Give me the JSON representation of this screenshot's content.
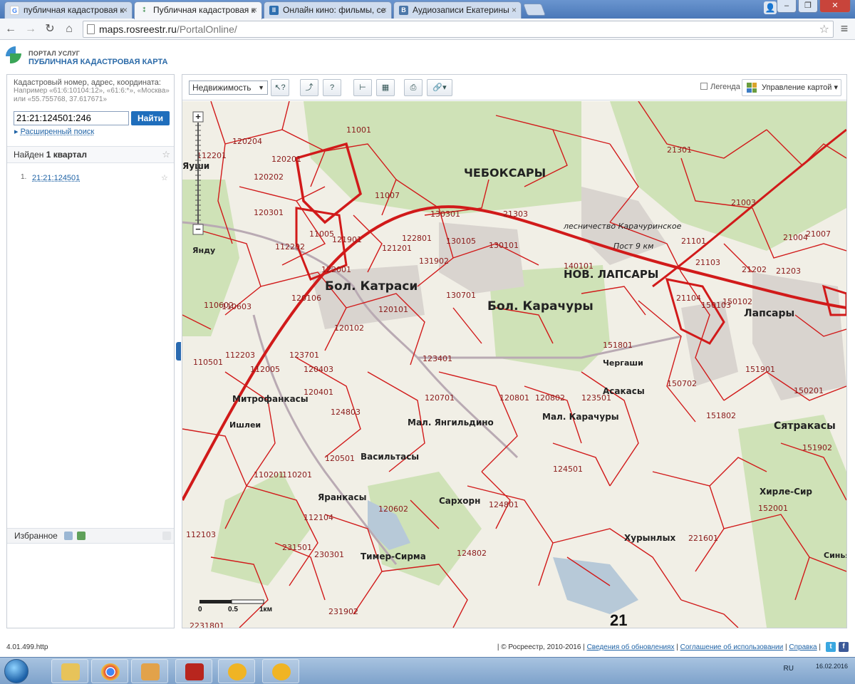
{
  "browser": {
    "tabs": [
      {
        "title": "публичная кадастровая к",
        "icon": "google-icon"
      },
      {
        "title": "Публичная кадастровая к",
        "icon": "rosreestr-icon",
        "active": true
      },
      {
        "title": "Онлайн кино: фильмы, се",
        "icon": "video-icon"
      },
      {
        "title": "Аудиозаписи Екатерины",
        "icon": "vk-icon"
      }
    ],
    "url_host": "maps.rosreestr.ru",
    "url_path": "/PortalOnline/"
  },
  "portal": {
    "subtitle": "ПОРТАЛ УСЛУГ",
    "title": "ПУБЛИЧНАЯ КАДАСТРОВАЯ КАРТА"
  },
  "search": {
    "hint": "Кадастровый номер, адрес, координата:",
    "examples": "Например «61:6:10104:12», «61:6:*», «Москва» или «55.755768, 37.617671»",
    "value": "21:21:124501:246",
    "button": "Найти",
    "advanced": "Расширенный поиск"
  },
  "results": {
    "found_prefix": "Найден",
    "found_count": "1 квартал",
    "items": [
      {
        "num": "1.",
        "label": "21:21:124501"
      }
    ]
  },
  "favorites": {
    "label": "Избранное"
  },
  "map_toolbar": {
    "layer_select": "Недвижимость",
    "legend_label": "Легенда",
    "manage_label": "Управление картой"
  },
  "map": {
    "places": [
      {
        "name": "ЧЕБОКСАРЫ"
      },
      {
        "name": "Бол. Катраси"
      },
      {
        "name": "Бол. Карачуры"
      },
      {
        "name": "НОВ. ЛАПСАРЫ"
      },
      {
        "name": "Лапсары"
      },
      {
        "name": "Митрофанкасы"
      },
      {
        "name": "Мал. Янгильдино"
      },
      {
        "name": "Мал. Карачуры"
      },
      {
        "name": "Асакасы"
      },
      {
        "name": "Чергаши"
      },
      {
        "name": "Сятракасы"
      },
      {
        "name": "Васильтасы"
      },
      {
        "name": "Сархорн"
      },
      {
        "name": "Яранкасы"
      },
      {
        "name": "Хирле-Сир"
      },
      {
        "name": "Хурынлых"
      },
      {
        "name": "Тимер-Сирма"
      },
      {
        "name": "Синьял"
      },
      {
        "name": "Ишлеи"
      },
      {
        "name": "Янду"
      },
      {
        "name": "Яуши"
      },
      {
        "name": "лесничество Карачуринское"
      },
      {
        "name": "Пост 9 км"
      }
    ],
    "parcels": [
      "11001",
      "11005",
      "11007",
      "21301",
      "21303",
      "130301",
      "21003",
      "130105",
      "130101",
      "140101",
      "121901",
      "122001",
      "121201",
      "122801",
      "131902",
      "130701",
      "120101",
      "120102",
      "120106",
      "112202",
      "110602",
      "110603",
      "110501",
      "112203",
      "112005",
      "123701",
      "120403",
      "120401",
      "124803",
      "120501",
      "110201",
      "110201",
      "112104",
      "124501",
      "124801",
      "124802",
      "120602",
      "120801",
      "120802",
      "123401",
      "123501",
      "120701",
      "151801",
      "150702",
      "151802",
      "150103",
      "150102",
      "151901",
      "21104",
      "21101",
      "21103",
      "21202",
      "21203",
      "21004",
      "21007",
      "152001",
      "151902",
      "150201",
      "221601",
      "231501",
      "230301",
      "231902",
      "112103",
      "112201",
      "120204",
      "120201",
      "120202",
      "120301",
      "2231801"
    ],
    "scale": {
      "zero": "0",
      "half": "0.5",
      "one": "1км"
    },
    "big_label": "21",
    "zoom_plus": "+",
    "zoom_minus": "−"
  },
  "footer": {
    "version": "4.01.499.http",
    "copyright": "| © Росреестр, 2010-2016 |",
    "links": [
      "Сведения об обновлениях",
      "Соглашение об использовании",
      "Справка"
    ]
  },
  "taskbar": {
    "lang": "RU",
    "date": "16.02.2016"
  },
  "colors": {
    "parcel_line": "#d11a1a",
    "accent": "#1f6ebc",
    "forest": "#cfe2b7",
    "map_bg": "#f1efe6"
  }
}
